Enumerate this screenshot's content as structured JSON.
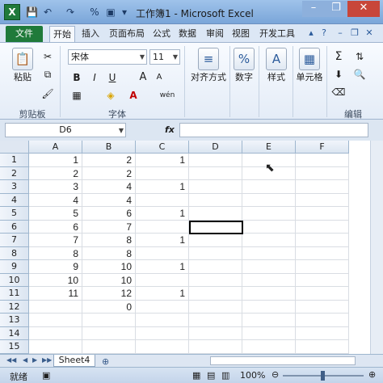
{
  "app": {
    "window_title": "工作簿1 - Microsoft Excel",
    "logo_letter": "X"
  },
  "colors": {
    "file_tab": "#1f7a3a",
    "accent": "#2b5b9b",
    "ribbon_bg": "#e4ecf7"
  },
  "ribbon_tabs": [
    "文件",
    "开始",
    "插入",
    "页面布局",
    "公式",
    "数据",
    "审阅",
    "视图",
    "开发工具"
  ],
  "active_tab": "开始",
  "clipboard": {
    "paste_label": "粘贴",
    "group_label": "剪贴板"
  },
  "font_group": {
    "font_name": "宋体",
    "font_size": "11",
    "group_label": "字体",
    "bold": "B",
    "italic": "I",
    "underline": "U",
    "grow": "A",
    "wen": "wén"
  },
  "alignment": {
    "label": "对齐方式"
  },
  "number": {
    "label": "数字",
    "symbol": "%"
  },
  "style": {
    "label": "样式"
  },
  "cells_group": {
    "label": "单元格"
  },
  "editing": {
    "label": "编辑",
    "sigma": "Σ"
  },
  "formula_bar": {
    "name_box": "D6",
    "fx": "fx",
    "content": ""
  },
  "columns": [
    "A",
    "B",
    "C",
    "D",
    "E",
    "F"
  ],
  "rows": [
    "1",
    "2",
    "3",
    "4",
    "5",
    "6",
    "7",
    "8",
    "9",
    "10",
    "11",
    "12",
    "13",
    "14",
    "15"
  ],
  "table_rows": [
    [
      "1",
      "2",
      "1"
    ],
    [
      "2",
      "2",
      ""
    ],
    [
      "3",
      "4",
      "1"
    ],
    [
      "4",
      "4",
      ""
    ],
    [
      "5",
      "6",
      "1"
    ],
    [
      "6",
      "7",
      ""
    ],
    [
      "7",
      "8",
      "1"
    ],
    [
      "8",
      "8",
      ""
    ],
    [
      "9",
      "10",
      "1"
    ],
    [
      "10",
      "10",
      ""
    ],
    [
      "11",
      "12",
      "1"
    ],
    [
      "",
      "0",
      ""
    ],
    [
      "",
      "",
      ""
    ],
    [
      "",
      "",
      ""
    ],
    [
      "",
      "",
      ""
    ]
  ],
  "sheet": {
    "tab_name": "Sheet4"
  },
  "status": {
    "ready": "就绪",
    "zoom": "100%"
  }
}
